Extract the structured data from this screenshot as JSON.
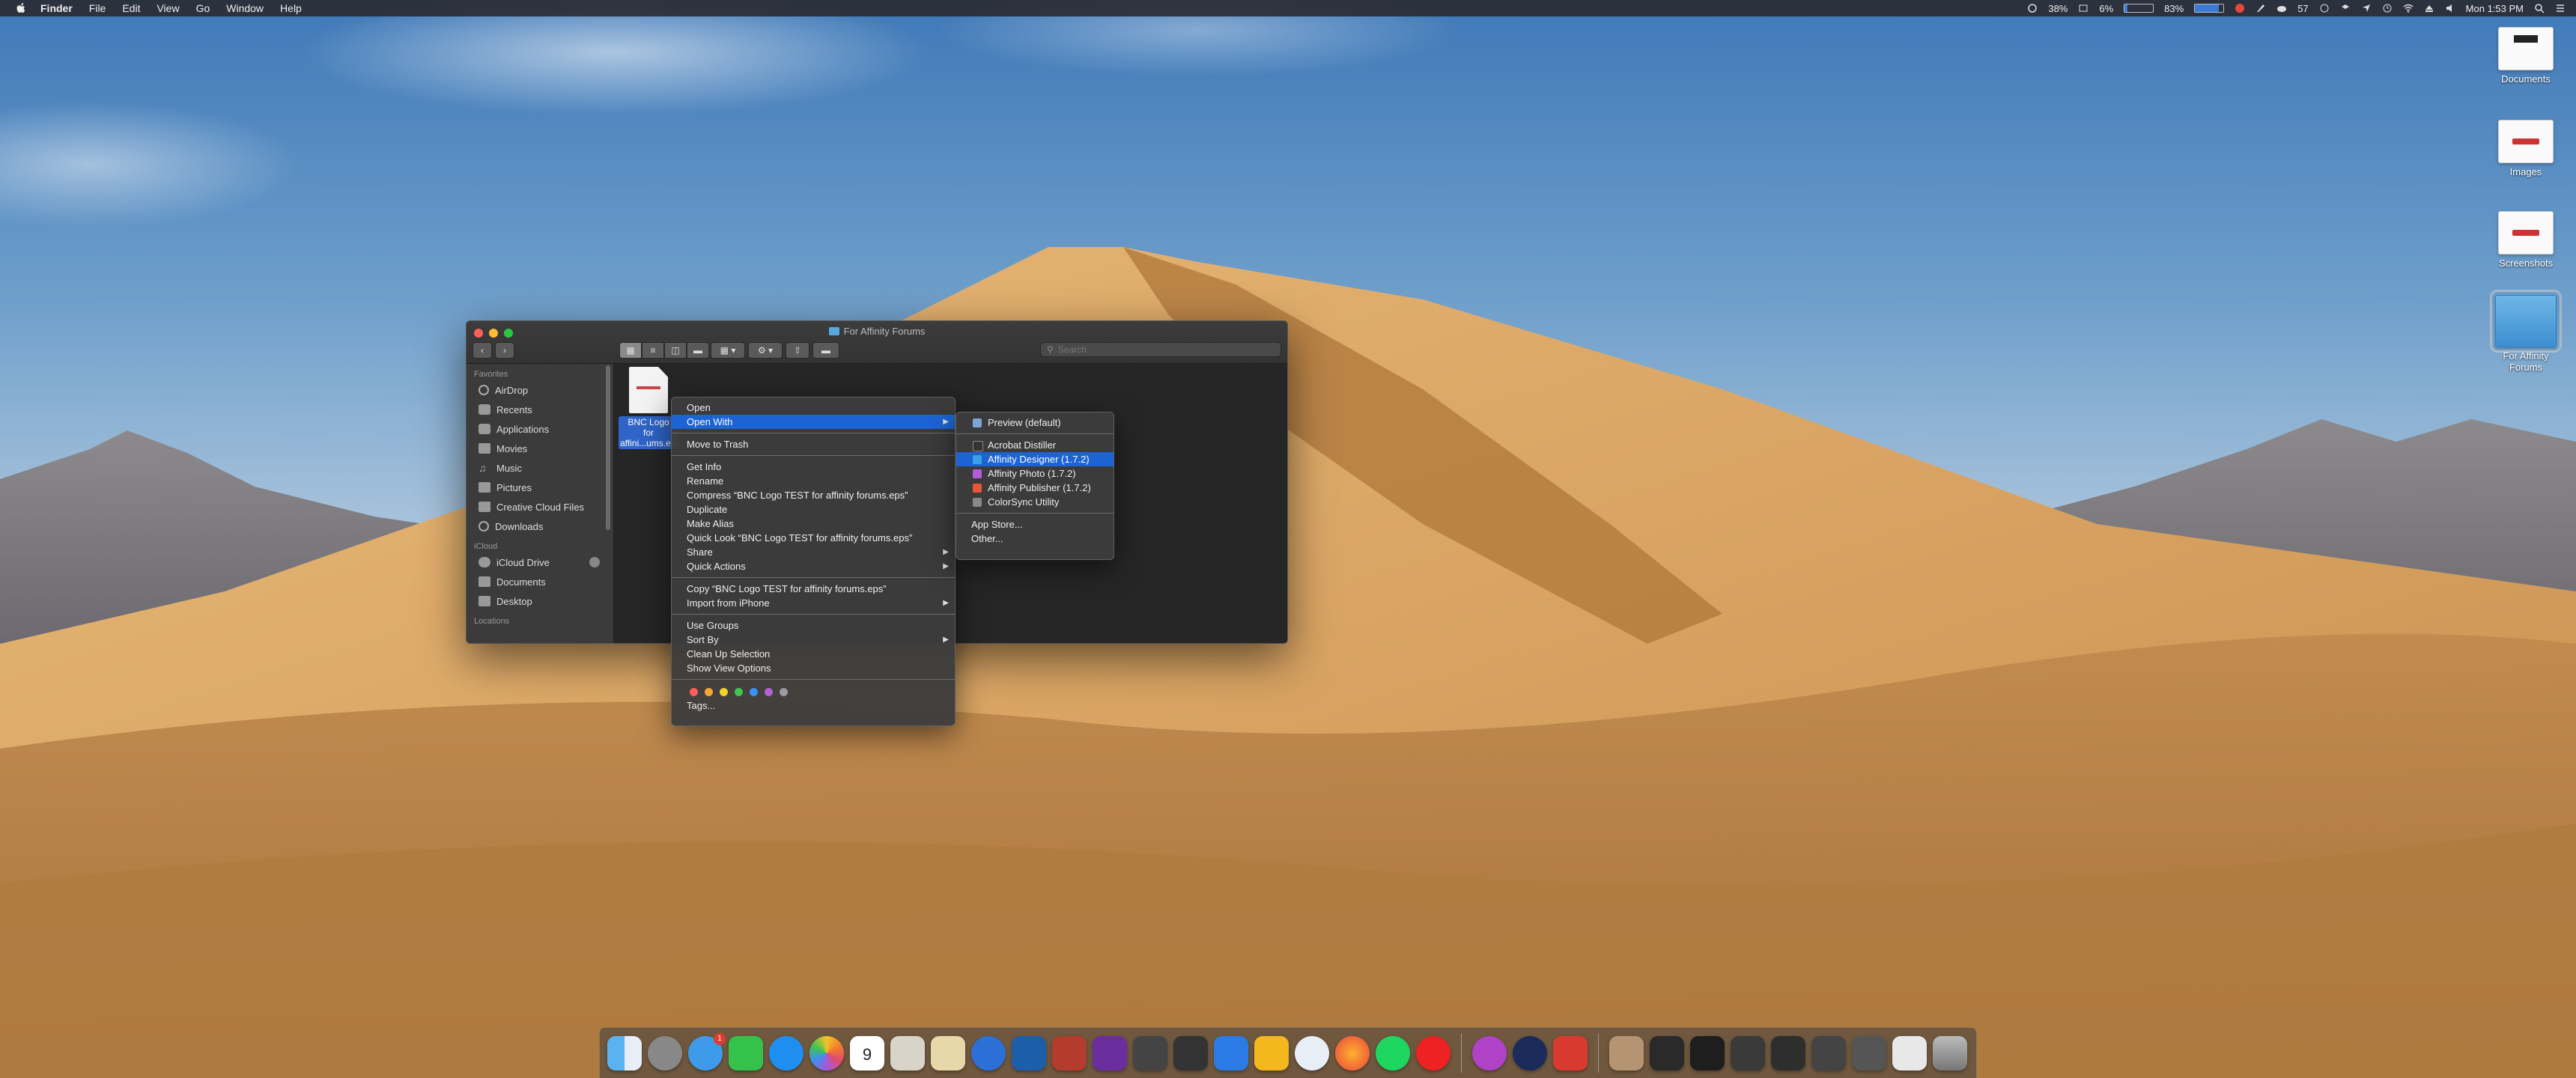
{
  "menubar": {
    "app": "Finder",
    "items": [
      "File",
      "Edit",
      "View",
      "Go",
      "Window",
      "Help"
    ],
    "status": {
      "pct1": "38%",
      "pct2": "6%",
      "pct3": "83%",
      "count": "57",
      "clock": "Mon 1:53 PM"
    }
  },
  "desktop": {
    "icons": [
      {
        "label": "Documents"
      },
      {
        "label": "Images"
      },
      {
        "label": "Screenshots"
      },
      {
        "label": "For Affinity\nForums"
      }
    ]
  },
  "finder": {
    "title": "For Affinity Forums",
    "search_placeholder": "Search",
    "sidebar": {
      "favorites_header": "Favorites",
      "favorites": [
        "AirDrop",
        "Recents",
        "Applications",
        "Movies",
        "Music",
        "Pictures",
        "Creative Cloud Files",
        "Downloads"
      ],
      "icloud_header": "iCloud",
      "icloud": [
        "iCloud Drive",
        "Documents",
        "Desktop"
      ],
      "locations_header": "Locations"
    },
    "file": {
      "name": "BNC Logo\nfor affini...ums.eps"
    }
  },
  "context_menu": {
    "open": "Open",
    "open_with": "Open With",
    "move_to_trash": "Move to Trash",
    "get_info": "Get Info",
    "rename": "Rename",
    "compress": "Compress “BNC Logo TEST for affinity forums.eps”",
    "duplicate": "Duplicate",
    "make_alias": "Make Alias",
    "quick_look": "Quick Look “BNC Logo TEST for affinity forums.eps”",
    "share": "Share",
    "quick_actions": "Quick Actions",
    "copy": "Copy “BNC Logo TEST for affinity forums.eps”",
    "import_iphone": "Import from iPhone",
    "use_groups": "Use Groups",
    "sort_by": "Sort By",
    "clean_up": "Clean Up Selection",
    "view_options": "Show View Options",
    "tags": "Tags...",
    "tag_colors": [
      "#fe5f57",
      "#f7a530",
      "#f5d328",
      "#3fc64d",
      "#3c8ff5",
      "#b461d8",
      "#9b9b9f"
    ]
  },
  "open_with_menu": {
    "preview": "Preview (default)",
    "acrobat": "Acrobat Distiller",
    "designer": "Affinity Designer (1.7.2)",
    "photo": "Affinity Photo (1.7.2)",
    "publisher": "Affinity Publisher (1.7.2)",
    "colorsync": "ColorSync Utility",
    "app_store": "App Store...",
    "other": "Other..."
  },
  "dock": {
    "mail_badge": "1",
    "calendar_day": "9"
  }
}
